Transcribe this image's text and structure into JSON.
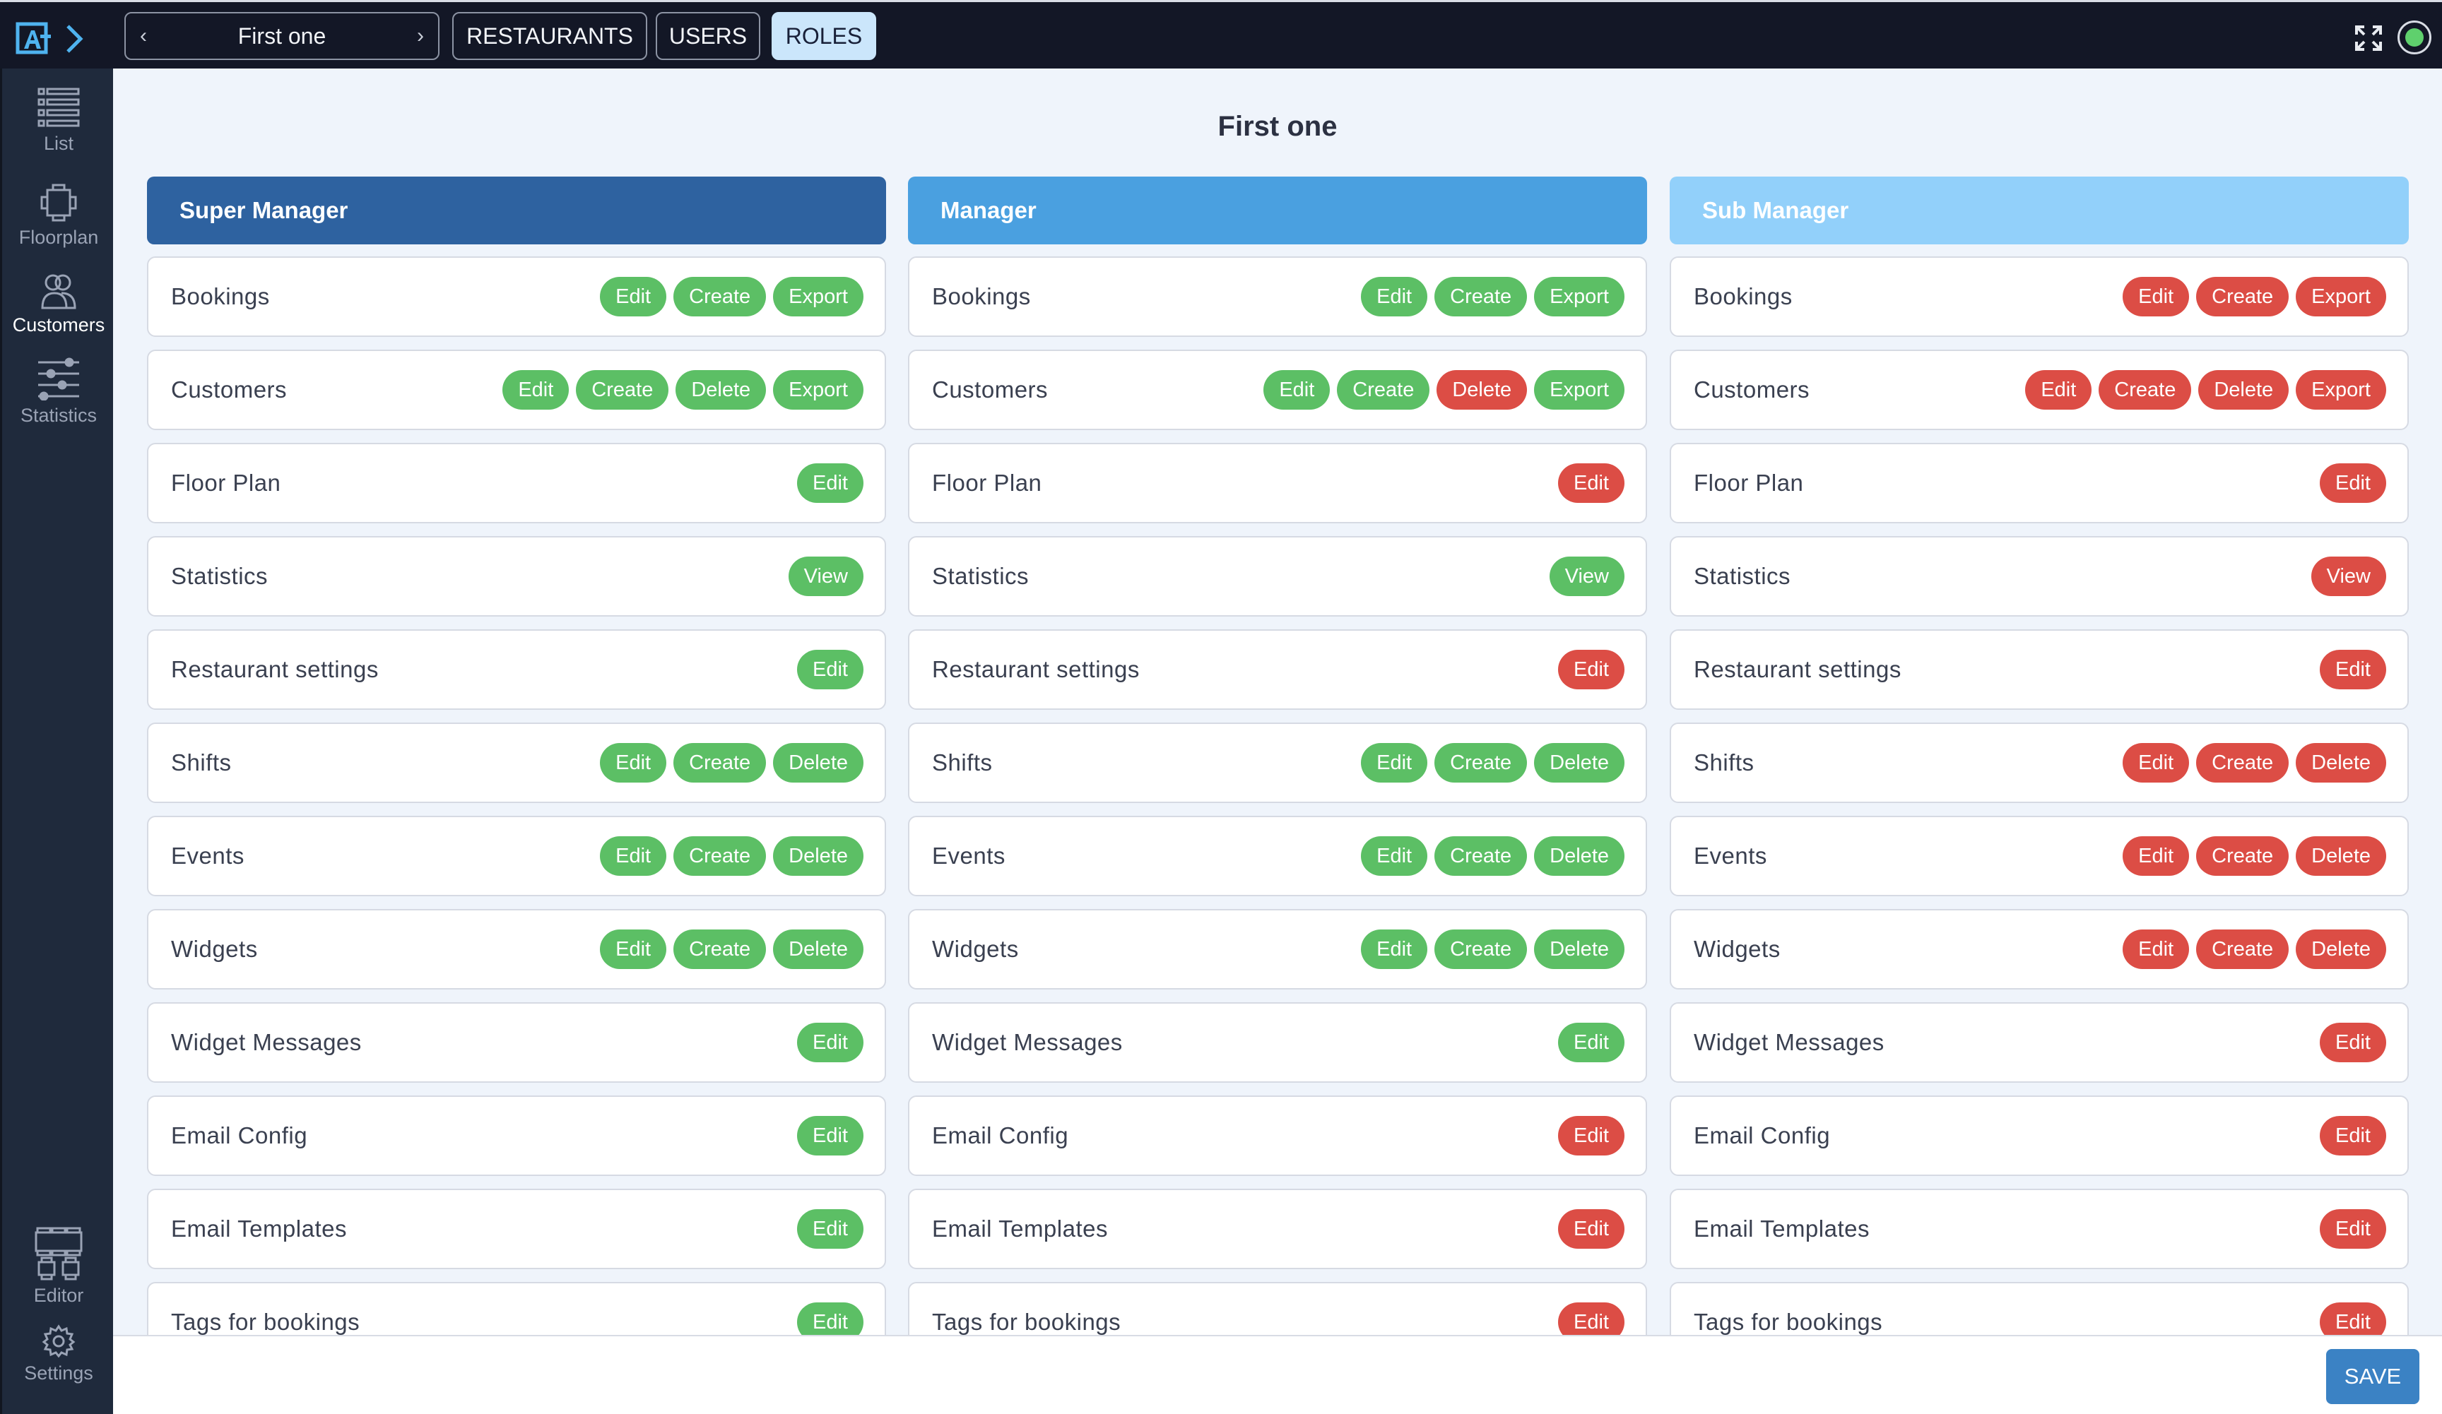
{
  "topbar": {
    "restaurant_selector": {
      "value": "First one",
      "prev_icon": "‹",
      "next_icon": "›"
    },
    "tabs": [
      {
        "label": "RESTAURANTS",
        "active": false
      },
      {
        "label": "USERS",
        "active": false
      },
      {
        "label": "ROLES",
        "active": true
      }
    ],
    "status": "online"
  },
  "sidebar": {
    "items": [
      {
        "label": "List",
        "icon": "list-icon",
        "active": false
      },
      {
        "label": "Floorplan",
        "icon": "floorplan-icon",
        "active": false
      },
      {
        "label": "Customers",
        "icon": "customers-icon",
        "active": true
      },
      {
        "label": "Statistics",
        "icon": "statistics-icon",
        "active": false
      }
    ],
    "bottom_items": [
      {
        "label": "Editor",
        "icon": "editor-icon"
      },
      {
        "label": "Settings",
        "icon": "settings-icon"
      }
    ]
  },
  "main": {
    "title": "First one",
    "colors": {
      "granted": "#5cbf65",
      "denied": "#dc4d45"
    },
    "roles": [
      {
        "name": "Super Manager",
        "header_color": "#2e62a0",
        "permissions": [
          {
            "label": "Bookings",
            "actions": [
              {
                "label": "Edit",
                "granted": true
              },
              {
                "label": "Create",
                "granted": true
              },
              {
                "label": "Export",
                "granted": true
              }
            ]
          },
          {
            "label": "Customers",
            "actions": [
              {
                "label": "Edit",
                "granted": true
              },
              {
                "label": "Create",
                "granted": true
              },
              {
                "label": "Delete",
                "granted": true
              },
              {
                "label": "Export",
                "granted": true
              }
            ]
          },
          {
            "label": "Floor Plan",
            "actions": [
              {
                "label": "Edit",
                "granted": true
              }
            ]
          },
          {
            "label": "Statistics",
            "actions": [
              {
                "label": "View",
                "granted": true
              }
            ]
          },
          {
            "label": "Restaurant settings",
            "actions": [
              {
                "label": "Edit",
                "granted": true
              }
            ]
          },
          {
            "label": "Shifts",
            "actions": [
              {
                "label": "Edit",
                "granted": true
              },
              {
                "label": "Create",
                "granted": true
              },
              {
                "label": "Delete",
                "granted": true
              }
            ]
          },
          {
            "label": "Events",
            "actions": [
              {
                "label": "Edit",
                "granted": true
              },
              {
                "label": "Create",
                "granted": true
              },
              {
                "label": "Delete",
                "granted": true
              }
            ]
          },
          {
            "label": "Widgets",
            "actions": [
              {
                "label": "Edit",
                "granted": true
              },
              {
                "label": "Create",
                "granted": true
              },
              {
                "label": "Delete",
                "granted": true
              }
            ]
          },
          {
            "label": "Widget Messages",
            "actions": [
              {
                "label": "Edit",
                "granted": true
              }
            ]
          },
          {
            "label": "Email Config",
            "actions": [
              {
                "label": "Edit",
                "granted": true
              }
            ]
          },
          {
            "label": "Email Templates",
            "actions": [
              {
                "label": "Edit",
                "granted": true
              }
            ]
          },
          {
            "label": "Tags for bookings",
            "actions": [
              {
                "label": "Edit",
                "granted": true
              }
            ]
          }
        ]
      },
      {
        "name": "Manager",
        "header_color": "#4aa0e0",
        "permissions": [
          {
            "label": "Bookings",
            "actions": [
              {
                "label": "Edit",
                "granted": true
              },
              {
                "label": "Create",
                "granted": true
              },
              {
                "label": "Export",
                "granted": true
              }
            ]
          },
          {
            "label": "Customers",
            "actions": [
              {
                "label": "Edit",
                "granted": true
              },
              {
                "label": "Create",
                "granted": true
              },
              {
                "label": "Delete",
                "granted": false
              },
              {
                "label": "Export",
                "granted": true
              }
            ]
          },
          {
            "label": "Floor Plan",
            "actions": [
              {
                "label": "Edit",
                "granted": false
              }
            ]
          },
          {
            "label": "Statistics",
            "actions": [
              {
                "label": "View",
                "granted": true
              }
            ]
          },
          {
            "label": "Restaurant settings",
            "actions": [
              {
                "label": "Edit",
                "granted": false
              }
            ]
          },
          {
            "label": "Shifts",
            "actions": [
              {
                "label": "Edit",
                "granted": true
              },
              {
                "label": "Create",
                "granted": true
              },
              {
                "label": "Delete",
                "granted": true
              }
            ]
          },
          {
            "label": "Events",
            "actions": [
              {
                "label": "Edit",
                "granted": true
              },
              {
                "label": "Create",
                "granted": true
              },
              {
                "label": "Delete",
                "granted": true
              }
            ]
          },
          {
            "label": "Widgets",
            "actions": [
              {
                "label": "Edit",
                "granted": true
              },
              {
                "label": "Create",
                "granted": true
              },
              {
                "label": "Delete",
                "granted": true
              }
            ]
          },
          {
            "label": "Widget Messages",
            "actions": [
              {
                "label": "Edit",
                "granted": true
              }
            ]
          },
          {
            "label": "Email Config",
            "actions": [
              {
                "label": "Edit",
                "granted": false
              }
            ]
          },
          {
            "label": "Email Templates",
            "actions": [
              {
                "label": "Edit",
                "granted": false
              }
            ]
          },
          {
            "label": "Tags for bookings",
            "actions": [
              {
                "label": "Edit",
                "granted": false
              }
            ]
          }
        ]
      },
      {
        "name": "Sub Manager",
        "header_color": "#92d0fa",
        "permissions": [
          {
            "label": "Bookings",
            "actions": [
              {
                "label": "Edit",
                "granted": false
              },
              {
                "label": "Create",
                "granted": false
              },
              {
                "label": "Export",
                "granted": false
              }
            ]
          },
          {
            "label": "Customers",
            "actions": [
              {
                "label": "Edit",
                "granted": false
              },
              {
                "label": "Create",
                "granted": false
              },
              {
                "label": "Delete",
                "granted": false
              },
              {
                "label": "Export",
                "granted": false
              }
            ]
          },
          {
            "label": "Floor Plan",
            "actions": [
              {
                "label": "Edit",
                "granted": false
              }
            ]
          },
          {
            "label": "Statistics",
            "actions": [
              {
                "label": "View",
                "granted": false
              }
            ]
          },
          {
            "label": "Restaurant settings",
            "actions": [
              {
                "label": "Edit",
                "granted": false
              }
            ]
          },
          {
            "label": "Shifts",
            "actions": [
              {
                "label": "Edit",
                "granted": false
              },
              {
                "label": "Create",
                "granted": false
              },
              {
                "label": "Delete",
                "granted": false
              }
            ]
          },
          {
            "label": "Events",
            "actions": [
              {
                "label": "Edit",
                "granted": false
              },
              {
                "label": "Create",
                "granted": false
              },
              {
                "label": "Delete",
                "granted": false
              }
            ]
          },
          {
            "label": "Widgets",
            "actions": [
              {
                "label": "Edit",
                "granted": false
              },
              {
                "label": "Create",
                "granted": false
              },
              {
                "label": "Delete",
                "granted": false
              }
            ]
          },
          {
            "label": "Widget Messages",
            "actions": [
              {
                "label": "Edit",
                "granted": false
              }
            ]
          },
          {
            "label": "Email Config",
            "actions": [
              {
                "label": "Edit",
                "granted": false
              }
            ]
          },
          {
            "label": "Email Templates",
            "actions": [
              {
                "label": "Edit",
                "granted": false
              }
            ]
          },
          {
            "label": "Tags for bookings",
            "actions": [
              {
                "label": "Edit",
                "granted": false
              }
            ]
          }
        ]
      }
    ]
  },
  "footer": {
    "save_label": "SAVE"
  }
}
